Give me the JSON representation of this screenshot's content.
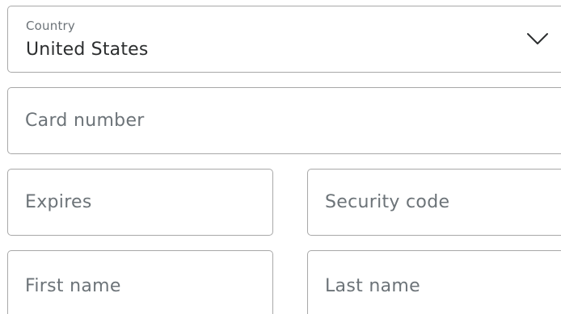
{
  "country": {
    "label": "Country",
    "value": "United States"
  },
  "card": {
    "placeholder": "Card number"
  },
  "expires": {
    "placeholder": "Expires"
  },
  "security": {
    "placeholder": "Security code"
  },
  "first_name": {
    "placeholder": "First name"
  },
  "last_name": {
    "placeholder": "Last name"
  },
  "icons": {
    "dropdown": "chevron-down-icon"
  },
  "colors": {
    "border": "#a8a8a8",
    "label": "#6c7378",
    "text": "#2c2e2f"
  }
}
